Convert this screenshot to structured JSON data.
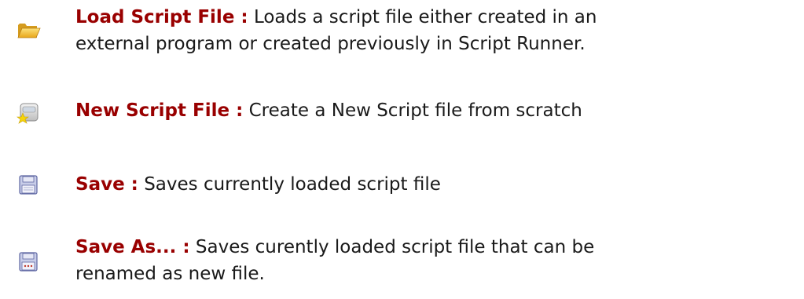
{
  "entries": [
    {
      "icon": "open-folder-icon",
      "term": "Load Script File :",
      "line1": "Loads a script file either created in an",
      "line2": "external program or created previously in Script Runner."
    },
    {
      "icon": "new-script-file-icon",
      "term": "New Script File :",
      "line1": "Create a New Script file from scratch"
    },
    {
      "icon": "save-floppy-icon",
      "term": "Save :",
      "line1": "Saves currently loaded script file"
    },
    {
      "icon": "save-as-floppy-icon",
      "term": "Save As... :",
      "line1": "Saves curently loaded script file that can be",
      "line2": "renamed as new file."
    }
  ],
  "colors": {
    "term": "#990000",
    "body_text": "#1a1a1a"
  }
}
